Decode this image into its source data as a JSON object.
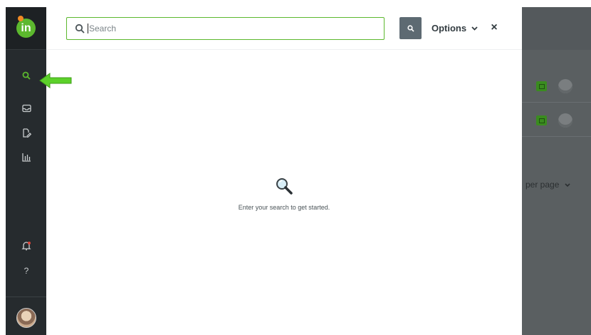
{
  "app": {
    "logo_text": "in",
    "brand_color": "#5cb82e"
  },
  "sidebar": {
    "items": [
      {
        "name": "search",
        "icon": "search-icon",
        "active": true
      },
      {
        "name": "inbox",
        "icon": "inbox-icon"
      },
      {
        "name": "files",
        "icon": "file-edit-icon"
      },
      {
        "name": "reports",
        "icon": "bar-chart-icon"
      },
      {
        "name": "notifications",
        "icon": "bell-icon"
      },
      {
        "name": "help",
        "icon": "question-icon",
        "label": "?"
      }
    ]
  },
  "search": {
    "placeholder": "Search",
    "button_icon": "search-icon",
    "options_label": "Options",
    "close_label": "×"
  },
  "empty_state": {
    "icon": "magnifier-icon",
    "message": "Enter your search to get started."
  },
  "background": {
    "per_page_label": "per page"
  }
}
